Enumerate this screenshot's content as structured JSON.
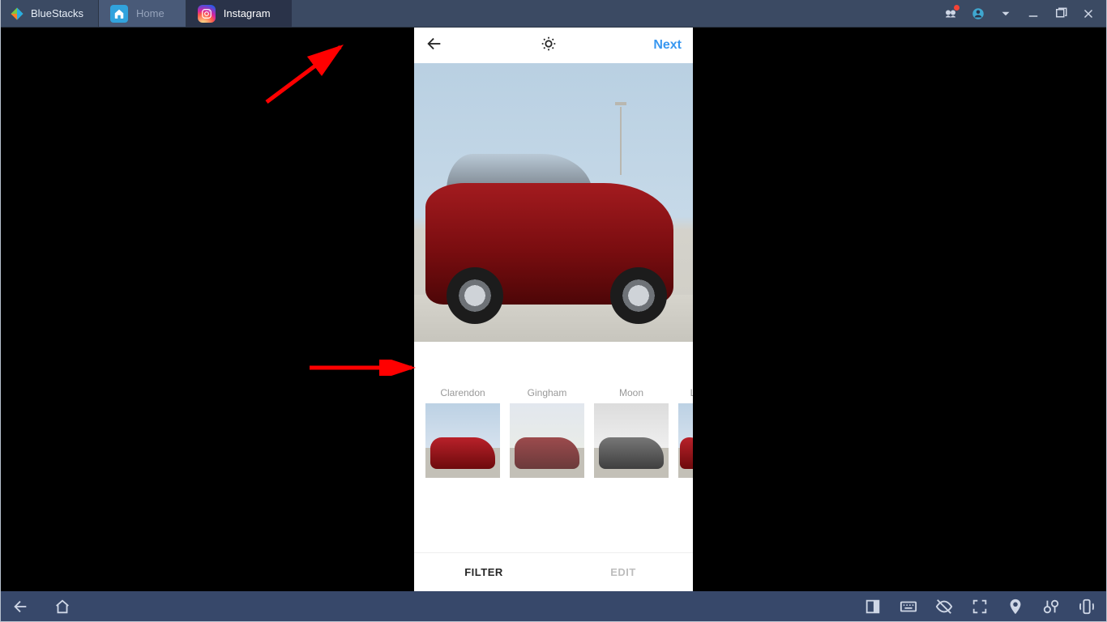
{
  "app": {
    "name": "BlueStacks"
  },
  "tabs": {
    "home": {
      "label": "Home"
    },
    "instagram": {
      "label": "Instagram"
    }
  },
  "ig": {
    "next_label": "Next",
    "filters": [
      {
        "name": "Clarendon"
      },
      {
        "name": "Gingham"
      },
      {
        "name": "Moon"
      },
      {
        "name": "L"
      }
    ],
    "tabs": {
      "filter": "FILTER",
      "edit": "EDIT"
    }
  }
}
